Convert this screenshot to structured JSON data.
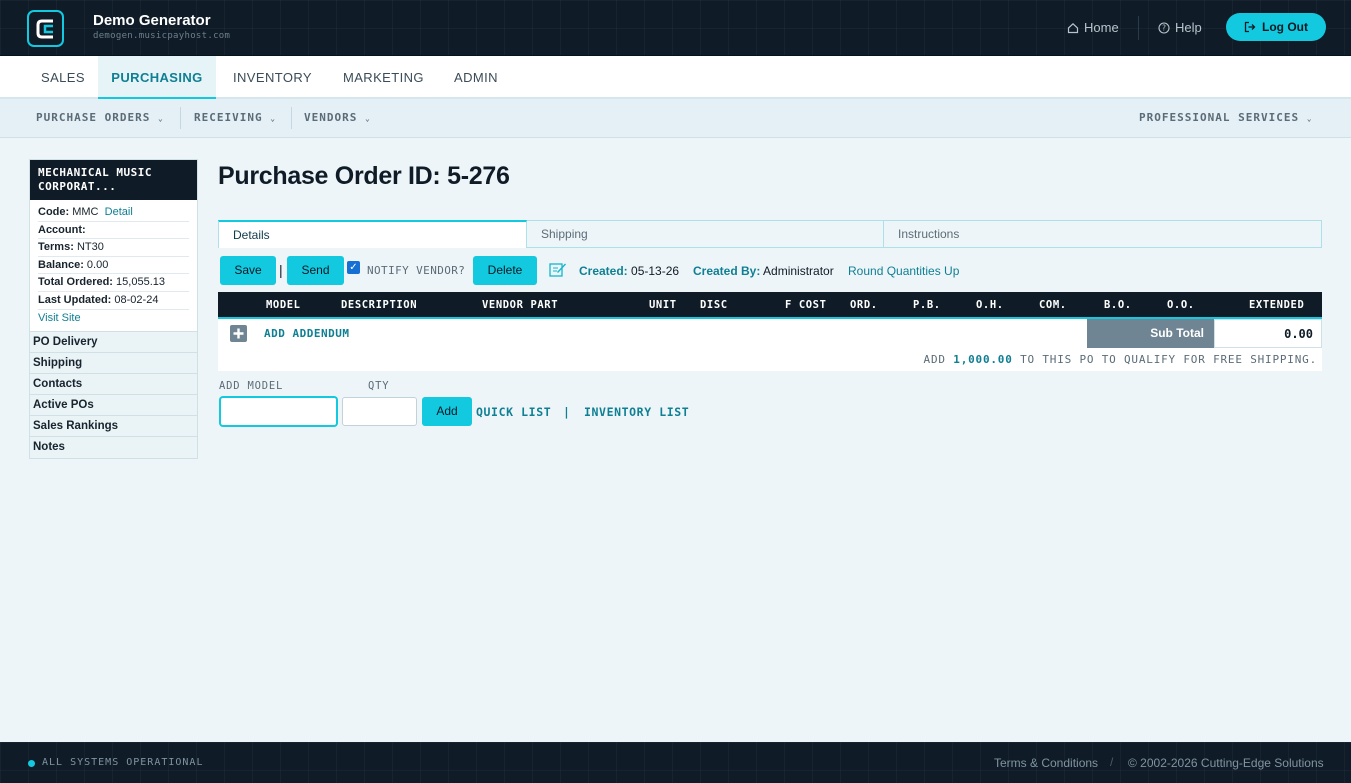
{
  "app": {
    "title": "Demo Generator",
    "subtitle": "demogen.musicpayhost.com"
  },
  "header": {
    "home": "Home",
    "help": "Help",
    "logout": "Log Out"
  },
  "main_nav": [
    "SALES",
    "PURCHASING",
    "INVENTORY",
    "MARKETING",
    "ADMIN"
  ],
  "sub_nav": {
    "purchase_orders": "PURCHASE ORDERS",
    "receiving": "RECEIVING",
    "vendors": "VENDORS",
    "professional_services": "PROFESSIONAL SERVICES"
  },
  "vendor": {
    "name_line1": "MECHANICAL MUSIC",
    "name_line2": "CORPORAT...",
    "code_label": "Code:",
    "code": "MMC",
    "detail_link": "Detail",
    "account_label": "Account:",
    "account": "",
    "terms_label": "Terms:",
    "terms": "NT30",
    "balance_label": "Balance:",
    "balance": "0.00",
    "total_ordered_label": "Total Ordered:",
    "total_ordered": "15,055.13",
    "last_updated_label": "Last Updated:",
    "last_updated": "08-02-24",
    "visit_site": "Visit Site"
  },
  "side_links": [
    "PO Delivery",
    "Shipping",
    "Contacts",
    "Active POs",
    "Sales Rankings",
    "Notes"
  ],
  "po": {
    "title": "Purchase Order ID: 5-276",
    "tabs": [
      "Details",
      "Shipping",
      "Instructions"
    ],
    "save": "Save",
    "send": "Send",
    "notify_vendor": "NOTIFY VENDOR?",
    "delete": "Delete",
    "created_label": "Created:",
    "created": "05-13-26",
    "created_by_label": "Created By:",
    "created_by": "Administrator",
    "round_up": "Round Quantities Up"
  },
  "grid": {
    "columns": [
      "MODEL",
      "DESCRIPTION",
      "VENDOR PART",
      "UNIT",
      "DISC",
      "F COST",
      "ORD.",
      "P.B.",
      "O.H.",
      "COM.",
      "B.O.",
      "O.O.",
      "EXTENDED"
    ],
    "add_addendum": "ADD ADDENDUM",
    "subtotal_label": "Sub Total",
    "subtotal_value": "0.00",
    "free_ship_prefix": "ADD",
    "free_ship_amount": "1,000.00",
    "free_ship_suffix": "TO THIS PO TO QUALIFY FOR FREE SHIPPING."
  },
  "add_form": {
    "model_label": "ADD MODEL",
    "qty_label": "QTY",
    "model_value": "",
    "qty_value": "",
    "add": "Add",
    "quick_list": "QUICK LIST",
    "separator": "|",
    "inventory_list": "INVENTORY LIST"
  },
  "footer": {
    "status": "ALL SYSTEMS OPERATIONAL",
    "terms": "Terms & Conditions",
    "copyright": "© 2002-2026 Cutting-Edge Solutions"
  },
  "colors": {
    "accent": "#13c9e0",
    "dark": "#0f1c27",
    "link": "#0f7f93"
  }
}
